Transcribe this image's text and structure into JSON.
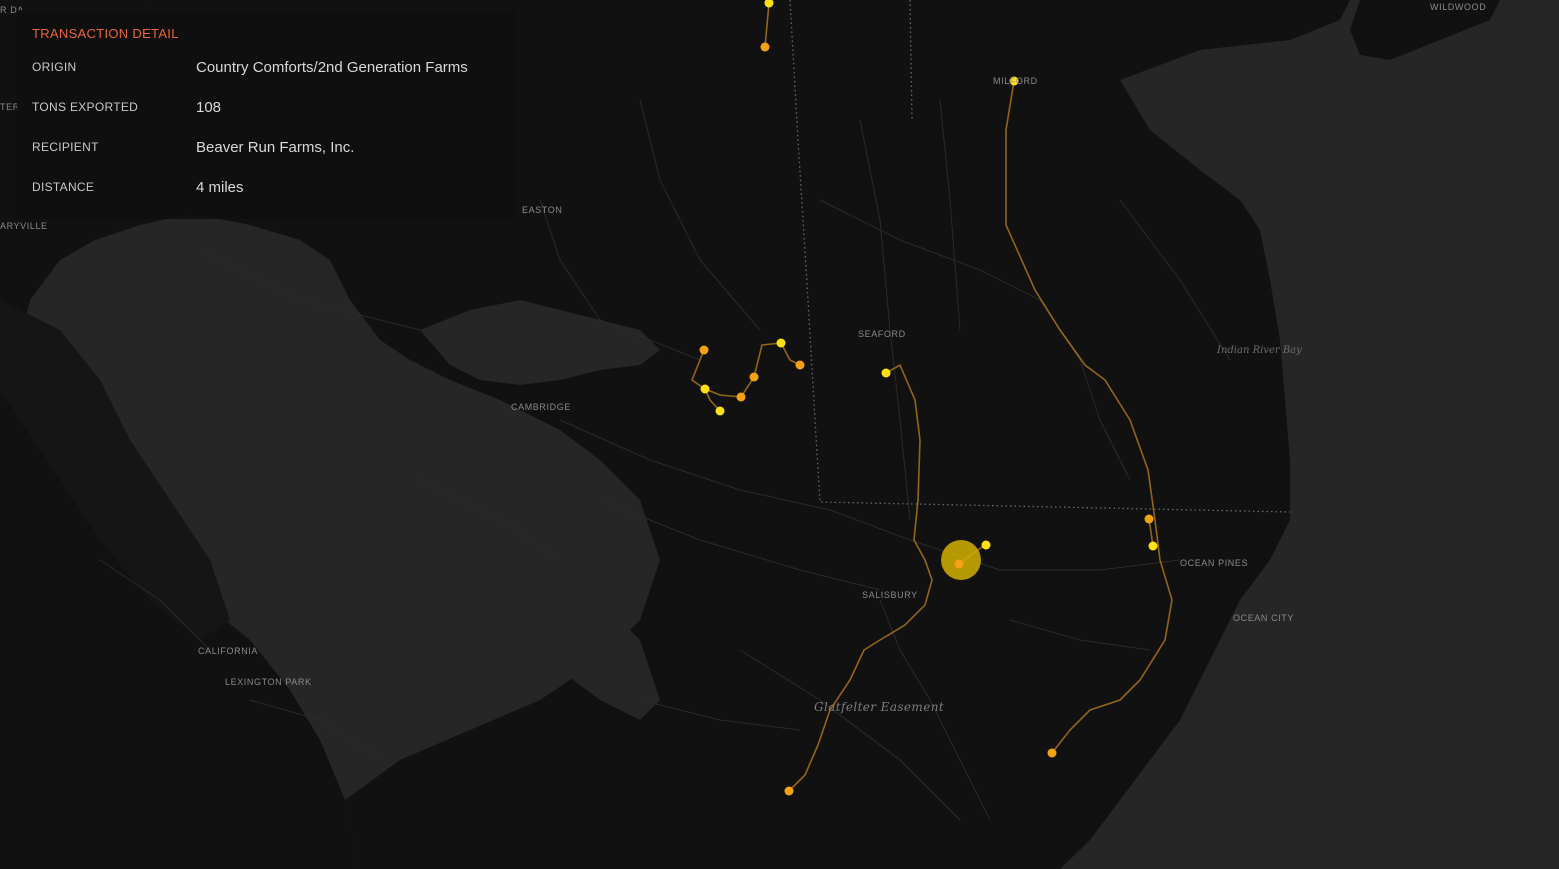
{
  "panel": {
    "title": "TRANSACTION DETAIL",
    "title_color": "#e8663b",
    "rows": [
      {
        "key": "ORIGIN",
        "value": "Country Comforts/2nd Generation Farms"
      },
      {
        "key": "TONS EXPORTED",
        "value": "108"
      },
      {
        "key": "RECIPIENT",
        "value": "Beaver Run Farms, Inc."
      },
      {
        "key": "DISTANCE",
        "value": "4 miles"
      }
    ]
  },
  "map": {
    "colors": {
      "land": "#111111",
      "water": "#262626",
      "roads": "#2a2a2a",
      "route": "#a8741c",
      "origin_marker": "#f5a113",
      "recipient_marker": "#ffe014",
      "selected_marker": "#d4b000"
    },
    "place_labels": [
      {
        "name": "place-label-wildwood",
        "text": "WILDWOOD"
      },
      {
        "name": "place-label-milford",
        "text": "MILFORD"
      },
      {
        "name": "place-label-easton",
        "text": "EASTON"
      },
      {
        "name": "place-label-maryville",
        "text": "ARYVILLE"
      },
      {
        "name": "place-label-seaford",
        "text": "SEAFORD"
      },
      {
        "name": "place-label-cambridge",
        "text": "CAMBRIDGE"
      },
      {
        "name": "place-label-salisbury",
        "text": "SALISBURY"
      },
      {
        "name": "place-label-ocean-pines",
        "text": "OCEAN PINES"
      },
      {
        "name": "place-label-ocean-city",
        "text": "OCEAN CITY"
      },
      {
        "name": "place-label-california",
        "text": "CALIFORNIA"
      },
      {
        "name": "place-label-lexington-park",
        "text": "LEXINGTON PARK"
      },
      {
        "name": "place-label-edge-top",
        "text": "R DA"
      },
      {
        "name": "place-label-edge-mid",
        "text": "TER"
      }
    ],
    "water_labels": [
      {
        "name": "water-label-indian-river-bay",
        "text": "Indian River Bay"
      }
    ],
    "park_labels": [
      {
        "name": "park-label-glatfelter-easement",
        "text": "Glatfelter Easement"
      }
    ]
  }
}
